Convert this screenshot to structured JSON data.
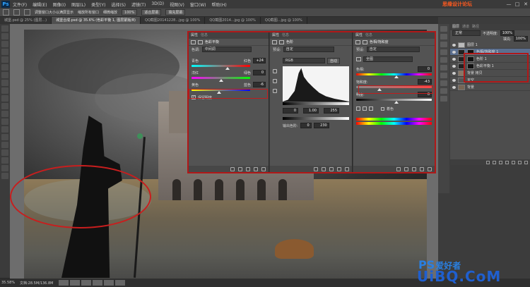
{
  "app": {
    "logo": "Ps",
    "site_watermark": "思缘设计论坛 WWW.MISSYUAN.COM"
  },
  "menu": [
    "文件(F)",
    "编辑(E)",
    "图像(I)",
    "图层(L)",
    "类型(Y)",
    "选择(S)",
    "滤镜(T)",
    "3D(D)",
    "视图(V)",
    "窗口(W)",
    "帮助(H)"
  ],
  "window_controls": {
    "minimize": "—",
    "maximize": "□",
    "close": "✕"
  },
  "options_bar": {
    "resize_windows": "调整窗口大小以满屏显示",
    "zoom_all": "缩放所有窗口",
    "scrubby_zoom": "细微缩放",
    "zoom_pct": "100%",
    "fit_screen": "适合屏幕",
    "fill_screen": "填充屏幕"
  },
  "doc_tabs": [
    {
      "label": "城堡.psd @ 25% (图层...)",
      "active": false
    },
    {
      "label": "城堡合成.psd @ 35.6% (色彩平衡 1, 图层蒙版/8)",
      "active": true
    },
    {
      "label": "QQ截图20141228...jpg @ 100%",
      "active": false
    },
    {
      "label": "QQ截图2014...jpg @ 100%",
      "active": false
    },
    {
      "label": "QQ截图...jpg @ 100%",
      "active": false
    }
  ],
  "status": {
    "zoom": "35.58%",
    "doc": "文档:28.5M/136.8M"
  },
  "color_balance": {
    "tabs": [
      "属性",
      "信息"
    ],
    "title": "色彩平衡",
    "tone_label": "色调:",
    "tone_value": "中间调",
    "sliders": [
      {
        "left": "青色",
        "right": "红色",
        "value": "+24",
        "knob": 0.62
      },
      {
        "left": "洋红",
        "right": "绿色",
        "value": "0",
        "knob": 0.5
      },
      {
        "left": "黄色",
        "right": "蓝色",
        "value": "-6",
        "knob": 0.47
      }
    ],
    "preserve_luminosity": "保留明度"
  },
  "levels": {
    "tabs": [
      "属性",
      "信息"
    ],
    "title": "色阶",
    "preset_label": "预设:",
    "preset_value": "自定",
    "channel_value": "RGB",
    "auto_button": "自动",
    "input_shadow": "0",
    "input_mid": "1.00",
    "input_high": "255",
    "output_label": "输出色阶:",
    "output_low": "0",
    "output_high": "230"
  },
  "hue_sat": {
    "tabs": [
      "属性",
      "信息"
    ],
    "title": "色相/饱和度",
    "preset_label": "预设:",
    "preset_value": "自定",
    "range_value": "全图",
    "hue_label": "色相:",
    "hue_value": "0",
    "sat_label": "饱和度:",
    "sat_value": "-43",
    "light_label": "明度:",
    "light_value": "0",
    "colorize_label": "着色"
  },
  "layers_panel": {
    "tabs": [
      "图层",
      "通道",
      "路径"
    ],
    "blend_mode": "正常",
    "opacity_label": "不透明度:",
    "opacity_value": "100%",
    "fill_label": "填充:",
    "fill_value": "100%",
    "layers": [
      {
        "name": "图层 1",
        "active": false
      },
      {
        "name": "色相/饱和度 1",
        "active": true
      },
      {
        "name": "色阶 1",
        "active": false
      },
      {
        "name": "色彩平衡 1",
        "active": false
      },
      {
        "name": "背景 拷贝",
        "active": false
      },
      {
        "name": "天空",
        "active": false
      },
      {
        "name": "背景",
        "active": false
      }
    ]
  },
  "bottom_watermark": {
    "ps": "PS",
    "cn": "爱好者",
    "site": "UiBQ.CoM"
  },
  "colors": {
    "annotation_red": "#c81e1e",
    "layer_highlight": "#5b6f8f",
    "ps_blue": "#2fa3ff"
  }
}
